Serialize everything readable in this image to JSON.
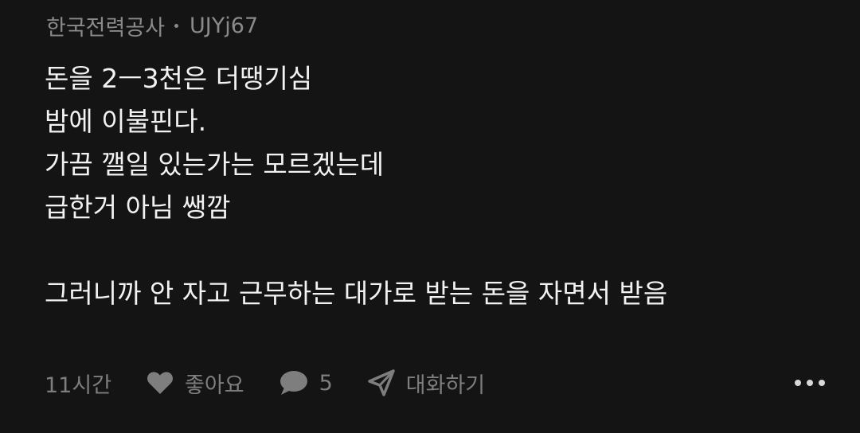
{
  "comment": {
    "author": "한국전력공사",
    "user_id": "UJYj67",
    "lines": [
      "돈을 2ㅡ3천은 더땡기심",
      "밤에 이불핀다.",
      "가끔 깰일 있는가는 모르겠는데",
      "급한거 아님 쌩깜",
      "",
      "그러니까 안 자고 근무하는 대가로 받는 돈을 자면서 받음"
    ],
    "time": "11시간",
    "like_label": "좋아요",
    "reply_count": "5",
    "chat_label": "대화하기"
  },
  "icons": {
    "like": "heart-icon",
    "reply": "speech-bubble-icon",
    "chat": "paper-plane-icon",
    "more": "more-dots-icon"
  },
  "colors": {
    "background": "#141414",
    "text": "#f2f2f2",
    "muted": "#8a8a8a",
    "icon": "#7e7e7e"
  }
}
